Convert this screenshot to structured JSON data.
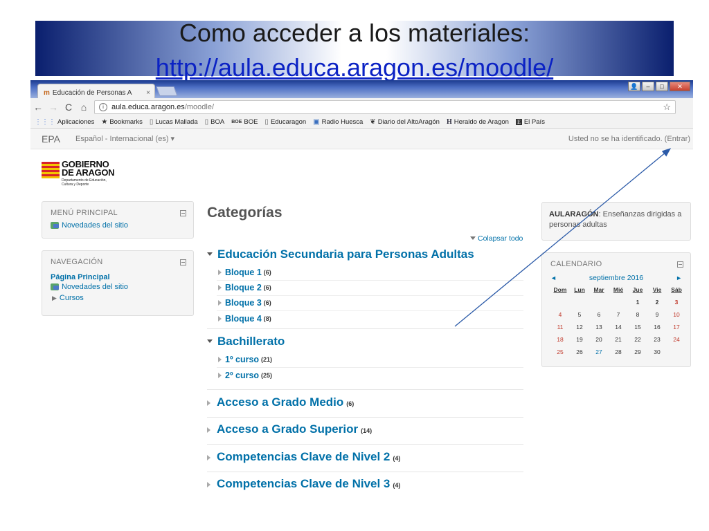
{
  "slide": {
    "title": "Como acceder a los materiales:",
    "url": "http://aula.educa.aragon.es/moodle/"
  },
  "browser": {
    "tab_title": "Educación de Personas A",
    "tab_close": "×",
    "address_host": "aula.educa.aragon.es",
    "address_path": "/moodle/",
    "bookmarks": [
      {
        "label": "Aplicaciones",
        "icon": "apps-grid-icon"
      },
      {
        "label": "Bookmarks",
        "icon": "star-icon"
      },
      {
        "label": "Lucas Mallada",
        "icon": "page-icon"
      },
      {
        "label": "BOA",
        "icon": "page-icon"
      },
      {
        "label": "BOE",
        "icon": "boe-icon"
      },
      {
        "label": "Educaragon",
        "icon": "page-icon"
      },
      {
        "label": "Radio Huesca",
        "icon": "radio-icon"
      },
      {
        "label": "Diario del AltoAragón",
        "icon": "diario-icon"
      },
      {
        "label": "Heraldo de Aragon",
        "icon": "heraldo-icon"
      },
      {
        "label": "El País",
        "icon": "elpais-icon"
      }
    ]
  },
  "moodle": {
    "brand": "EPA",
    "language": "Español - Internacional (es)",
    "login_text": "Usted no se ha identificado. (",
    "login_link": "Entrar",
    "login_close": ")",
    "logo": {
      "line1": "GOBIERNO",
      "line2": "DE ARAGON",
      "sub1": "Departamento de Educación,",
      "sub2": "Cultura y Deporte"
    },
    "main_menu": {
      "title": "MENÚ PRINCIPAL",
      "items": [
        "Novedades del sitio"
      ]
    },
    "navigation": {
      "title": "NAVEGACIÓN",
      "home": "Página Principal",
      "news": "Novedades del sitio",
      "courses": "Cursos"
    },
    "categories": {
      "heading": "Categorías",
      "collapse_all": "Colapsar todo",
      "list": [
        {
          "name": "Educación Secundaria para Personas Adultas",
          "count": ""
        },
        {
          "name": "Bachillerato",
          "count": ""
        },
        {
          "name": "Acceso a Grado Medio",
          "count": "(6)"
        },
        {
          "name": "Acceso a Grado Superior",
          "count": "(14)"
        },
        {
          "name": "Competencias Clave de Nivel 2",
          "count": "(4)"
        },
        {
          "name": "Competencias Clave de Nivel 3",
          "count": "(4)"
        }
      ],
      "sub_eso": [
        {
          "name": "Bloque 1",
          "count": "(6)"
        },
        {
          "name": "Bloque 2",
          "count": "(6)"
        },
        {
          "name": "Bloque 3",
          "count": "(6)"
        },
        {
          "name": "Bloque 4",
          "count": "(8)"
        }
      ],
      "sub_bach": [
        {
          "name": "1º curso",
          "count": "(21)"
        },
        {
          "name": "2º curso",
          "count": "(25)"
        }
      ]
    },
    "aularagon": {
      "title": "AULARAGÓN",
      "text": ": Enseñanzas dirigidas a personas adultas"
    },
    "calendar": {
      "title": "CALENDARIO",
      "month": "septiembre 2016",
      "prev": "◄",
      "next": "►",
      "dow": [
        "Dom",
        "Lun",
        "Mar",
        "Mié",
        "Jue",
        "Vie",
        "Sáb"
      ],
      "weeks": [
        [
          "",
          "",
          "",
          "",
          "1",
          "2",
          "3"
        ],
        [
          "4",
          "5",
          "6",
          "7",
          "8",
          "9",
          "10"
        ],
        [
          "11",
          "12",
          "13",
          "14",
          "15",
          "16",
          "17"
        ],
        [
          "18",
          "19",
          "20",
          "21",
          "22",
          "23",
          "24"
        ],
        [
          "25",
          "26",
          "27",
          "28",
          "29",
          "30",
          ""
        ]
      ],
      "today": "27"
    }
  },
  "colors": {
    "link": "#0070a8",
    "slide_url": "#0b22c4",
    "banner_dark": "#0a1f6e",
    "weekend": "#c0392b",
    "arrow": "#2b5aa8"
  }
}
